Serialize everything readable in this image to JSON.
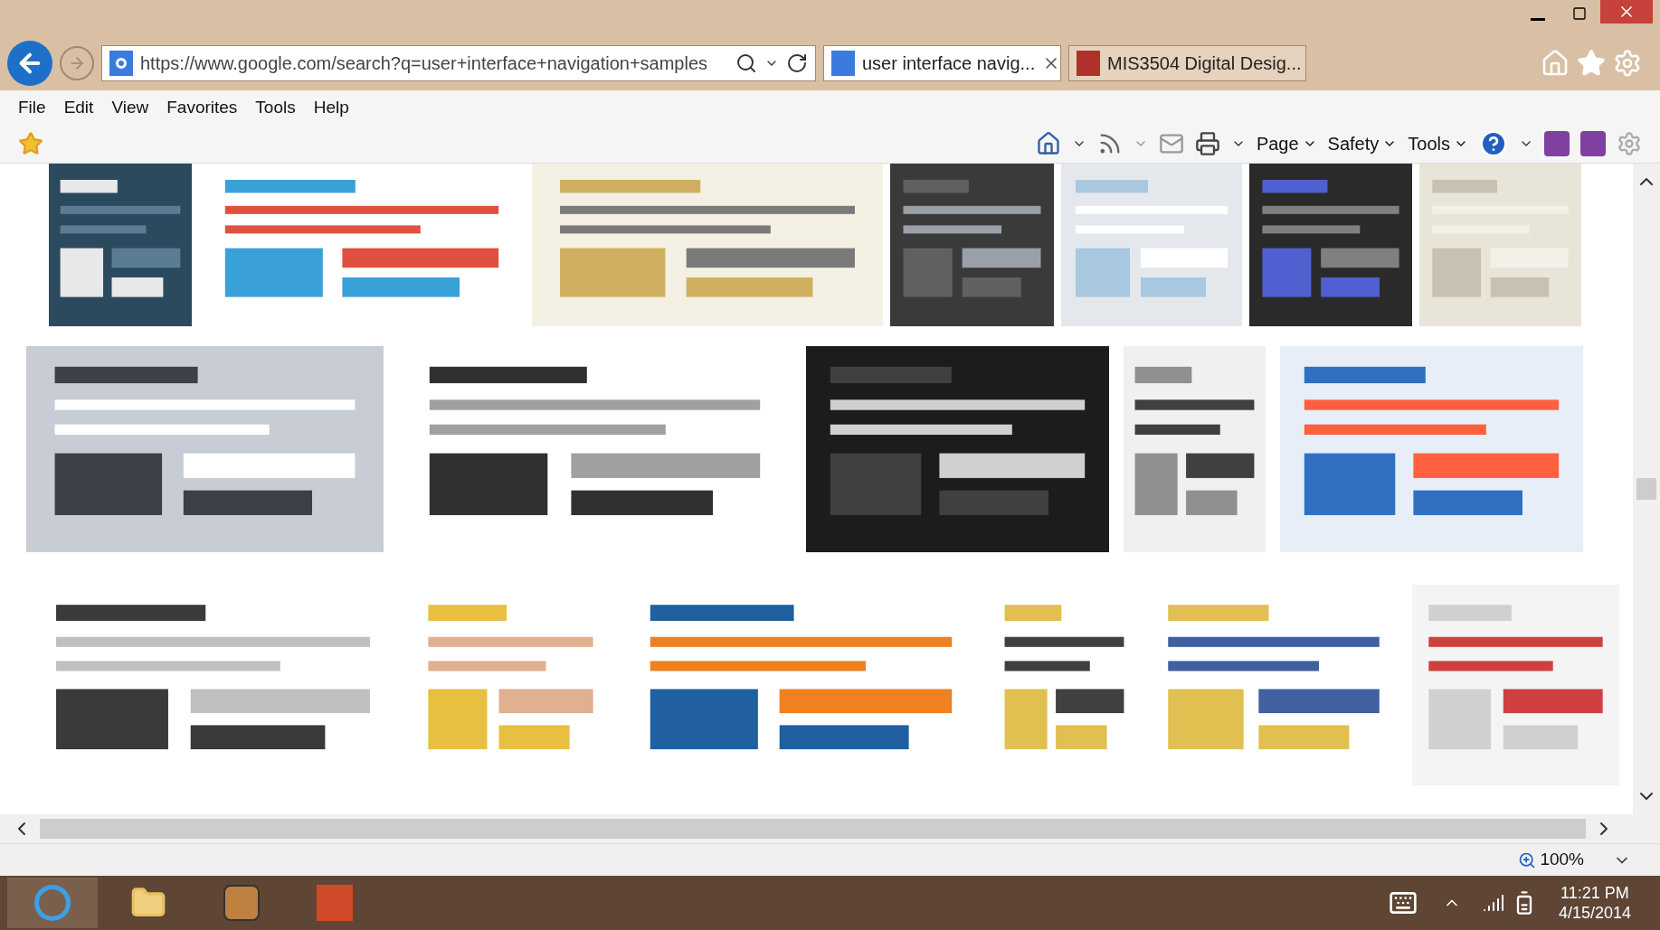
{
  "address_bar": {
    "url": "https://www.google.com/search?q=user+interface+navigation+samples"
  },
  "tabs": [
    {
      "title": "user interface navig...",
      "selected": true
    },
    {
      "title": "MIS3504 Digital Desig...",
      "selected": false
    }
  ],
  "menu": [
    "File",
    "Edit",
    "View",
    "Favorites",
    "Tools",
    "Help"
  ],
  "command_bar": [
    {
      "label": "Page"
    },
    {
      "label": "Safety"
    },
    {
      "label": "Tools"
    }
  ],
  "status_bar": {
    "zoom": "100%"
  },
  "taskbar": {
    "time": "11:21 PM",
    "date": "4/15/2014"
  }
}
